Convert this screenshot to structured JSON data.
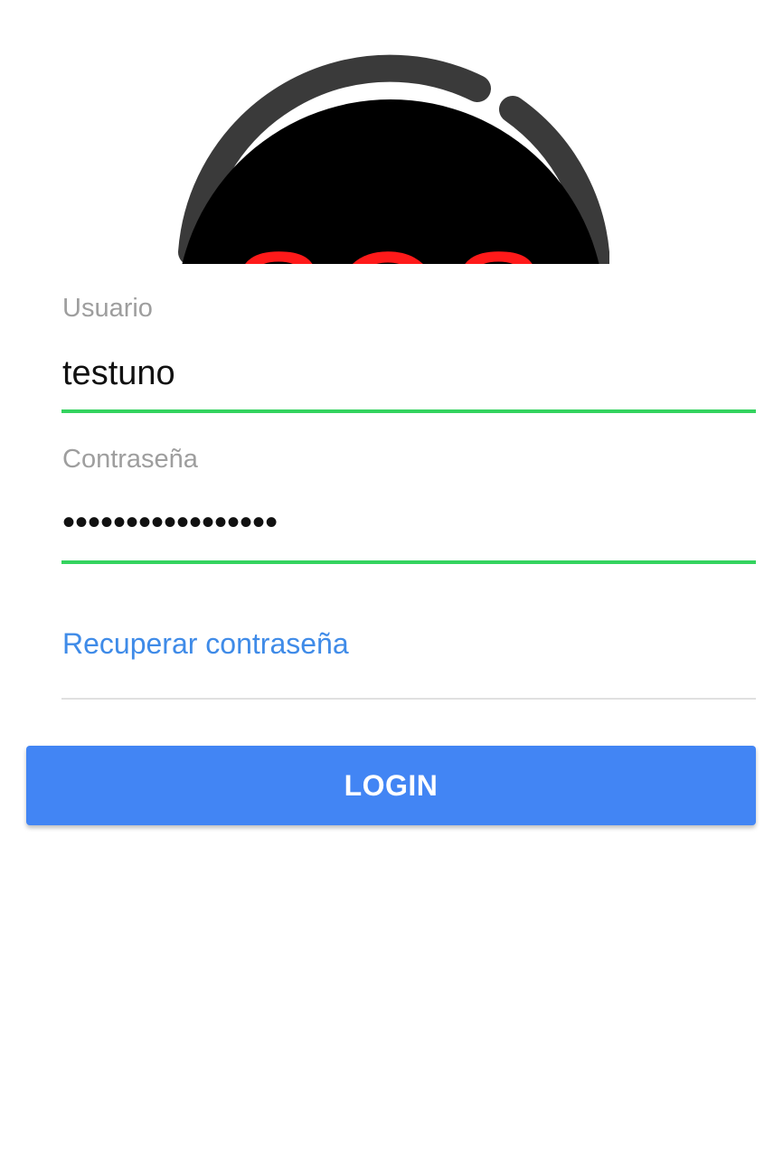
{
  "logo": {
    "text": "SOS",
    "colors": {
      "ring": "#3a3a3a",
      "disc": "#000000",
      "letters": "#ff1a1a"
    }
  },
  "username": {
    "label": "Usuario",
    "value": "testuno"
  },
  "password": {
    "label": "Contraseña",
    "masked_value": "•••••••••••••••••"
  },
  "recover_link": "Recuperar contraseña",
  "login_button": "LOGIN",
  "colors": {
    "input_underline": "#34d35f",
    "link": "#3f8be8",
    "button": "#4285f4"
  }
}
